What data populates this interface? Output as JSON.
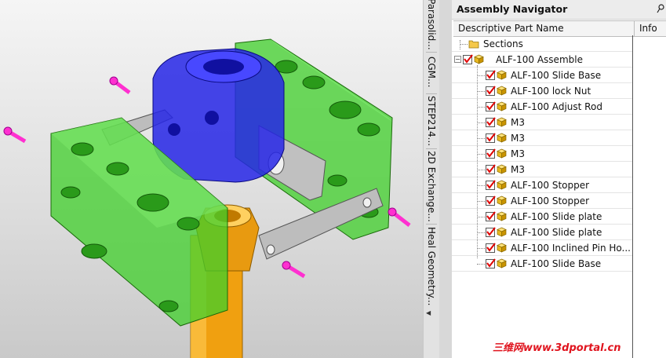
{
  "vertical_tabs": [
    "Parasolid...",
    "CGM...",
    "STEP214...",
    "2D Exchange...",
    "Heal Geometry..."
  ],
  "navigator": {
    "title": "Assembly Navigator",
    "columns": {
      "part": "Descriptive Part Name",
      "info": "Info"
    },
    "sections_label": "Sections",
    "root_label": "ALF-100 Assemble",
    "items": [
      {
        "label": "ALF-100 Slide Base"
      },
      {
        "label": "ALF-100 lock Nut"
      },
      {
        "label": "ALF-100 Adjust Rod"
      },
      {
        "label": "M3"
      },
      {
        "label": "M3"
      },
      {
        "label": "M3"
      },
      {
        "label": "M3"
      },
      {
        "label": "ALF-100 Stopper"
      },
      {
        "label": "ALF-100 Stopper"
      },
      {
        "label": "ALF-100 Slide plate"
      },
      {
        "label": "ALF-100 Slide plate"
      },
      {
        "label": "ALF-100 Inclined Pin Ho..."
      },
      {
        "label": "ALF-100 Slide Base"
      }
    ]
  },
  "watermark": "三维网www.3dportal.cn",
  "colors": {
    "part_green": "#3fcf2a",
    "nut_blue": "#2626e6",
    "rod_orange": "#f0a010",
    "plate_gray": "#b8b8b8",
    "pin_magenta": "#ff30d0",
    "check_red": "#e00000"
  }
}
